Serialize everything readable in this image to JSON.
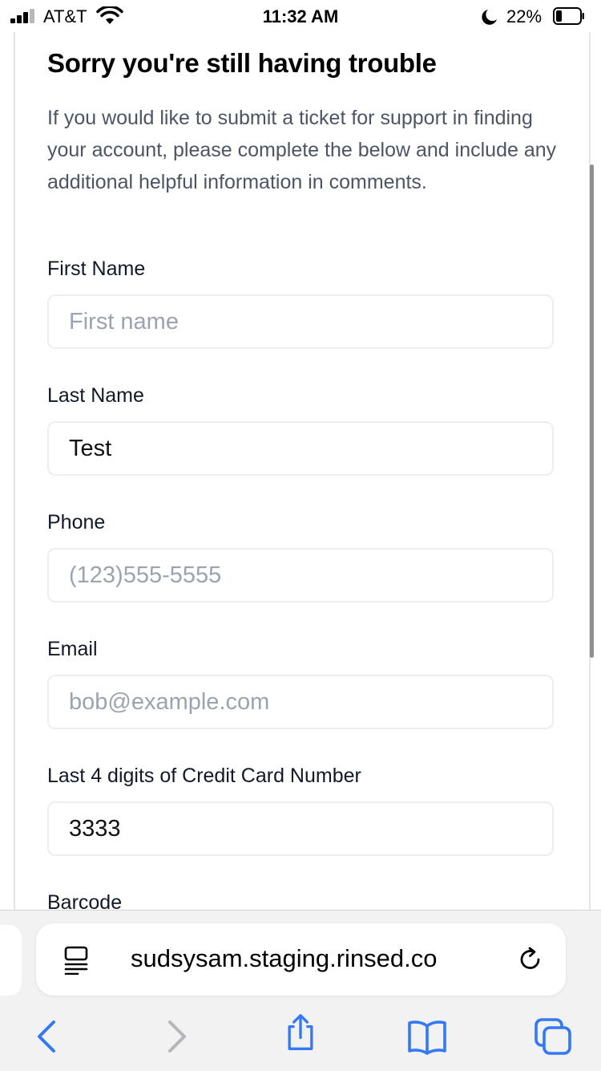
{
  "status_bar": {
    "carrier": "AT&T",
    "time": "11:32 AM",
    "battery_percent": "22%",
    "icons": [
      "signal-icon",
      "wifi-icon",
      "moon-icon",
      "battery-icon"
    ]
  },
  "form": {
    "title": "Sorry you're still having trouble",
    "description": "If you would like to submit a ticket for support in finding your account, please complete the below and include any additional helpful information in comments.",
    "fields": [
      {
        "label": "First Name",
        "value": "",
        "placeholder": "First name"
      },
      {
        "label": "Last Name",
        "value": "Test",
        "placeholder": ""
      },
      {
        "label": "Phone",
        "value": "",
        "placeholder": "(123)555-5555"
      },
      {
        "label": "Email",
        "value": "",
        "placeholder": "bob@example.com"
      },
      {
        "label": "Last 4 digits of Credit Card Number",
        "value": "3333",
        "placeholder": ""
      },
      {
        "label": "Barcode"
      }
    ]
  },
  "browser": {
    "url": "sudsysam.staging.rinsed.co",
    "icons": [
      "reader-icon",
      "reload-icon",
      "back-icon",
      "forward-icon",
      "share-icon",
      "bookmarks-icon",
      "tabs-icon"
    ],
    "accent_color": "#3478f6",
    "disabled_color": "#b5b5ba"
  }
}
